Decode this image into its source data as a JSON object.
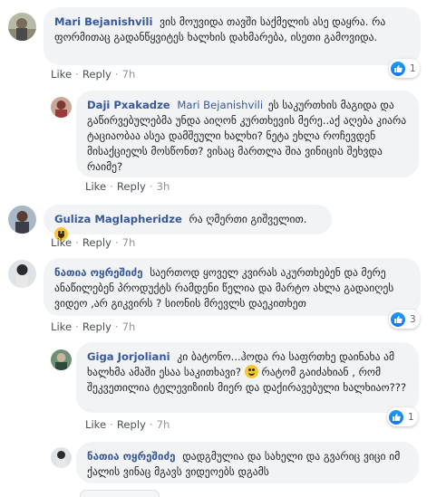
{
  "comments": [
    {
      "author": "Mari Bejanishvili",
      "mention": "",
      "text": "ვის მოუვიდა თავში საქმელის ასე დაყრა. რა ფორმითაც გადანწყვიტეს ხალხის დახმარება, ისეთი გამოვიდა.",
      "like_label": "Like",
      "reply_label": "Reply",
      "time": "7h",
      "reactions": "1"
    },
    {
      "author": "Daji Pxakadze",
      "mention": "Mari Bejanishvili",
      "text": "ეს საკურთხის მაგიდა და გაწირვებულებმა უნდა აიღონ კურთხევის მერე..აქ აღება კიარა ტაციაობაა ასეა დამშეული ხალხი? ნეტა ეხლა როჩევდენ მისაქციელს მოსწონთ? ვისაც მართლა შია ვინიცის შეხვდა რაიმე?",
      "like_label": "Like",
      "reply_label": "Reply",
      "time": "3h"
    },
    {
      "author": "Guliza Maglapheridze",
      "mention": "",
      "text": "რა ღმერთი გიშველით.",
      "like_label": "Like",
      "reply_label": "Reply",
      "time": "7h"
    },
    {
      "author": "ნათია ოყრეშიძე",
      "mention": "",
      "text": "საერთოდ ყოველ კვირას აკურთხებენ და მერე ანაწილებენ პროდუქტს რამდენი წელია და მარტო ახლა გადაიღეს ვიდეო ,არ გიკვირს ? სიონის მრევლს დაეკითხეთ",
      "like_label": "Like",
      "reply_label": "Reply",
      "time": "7h",
      "reactions": "3"
    },
    {
      "author": "Giga Jorjoliani",
      "mention": "",
      "text_before": "კი ბატონო...ჰოდა რა საფრთხე დაინახა ამ ხალხმა ამაში ესაა საკითხავი?",
      "text_after": "რატომ გაიძახიან , რომ შეკვეთილია ტელევიზიის მიერ და დაქირავებული ხალხიაო???",
      "like_label": "Like",
      "reply_label": "Reply",
      "time": "7h",
      "reactions": "1"
    },
    {
      "author": "ნათია ოყრეშიძე",
      "mention": "",
      "text": "დადგმულია და სახელი და გვარიც ვიცი იმ ქალის ვინაც მგავს ვიდეოებს დგამს"
    }
  ],
  "icons": {
    "like": "thumbs-up-icon",
    "smile": "smiling-face-emoji",
    "laugh": "laughing-face-emoji"
  },
  "colors": {
    "author": "#385898",
    "bubble": "#f2f3f5",
    "meta": "#606770",
    "like_badge": "#1877f2"
  }
}
